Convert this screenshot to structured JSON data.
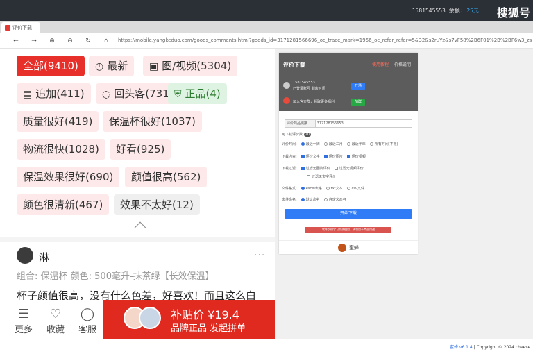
{
  "topbar": {
    "account": "1581545553",
    "balance_label": "余额:",
    "balance": "25元",
    "watermark": "搜狐号"
  },
  "tab": {
    "title": "评价下载"
  },
  "nav": {
    "icons": [
      "back-icon",
      "forward-icon",
      "zoom-in-icon",
      "zoom-out-icon",
      "reload-icon",
      "home-icon"
    ],
    "url": "https://mobile.yangkeduo.com/goods_comments.html?goods_id=3171281566696_oc_trace_mark=1956_oc_refer_refer=5&32&s2ruYz&s7vF58%2B6F01%2B%2BF6w3_zsH_gallery=https%3A%2F%2Fimg.pddpic"
  },
  "tags": [
    {
      "label": "全部(9410)",
      "icon": "",
      "style": "active"
    },
    {
      "label": "最新",
      "icon": "clock-icon",
      "style": "normal"
    },
    {
      "label": "图/视频(5304)",
      "icon": "image-icon",
      "style": "normal"
    },
    {
      "label": "追加(411)",
      "icon": "note-icon",
      "style": "normal"
    },
    {
      "label": "回头客(731)",
      "icon": "chat-icon",
      "style": "normal"
    },
    {
      "label": "正品(4)",
      "icon": "shield-check-icon",
      "style": "green"
    },
    {
      "label": "质量很好(419)",
      "icon": "",
      "style": "normal"
    },
    {
      "label": "保温杯很好(1037)",
      "icon": "",
      "style": "normal"
    },
    {
      "label": "物流很快(1028)",
      "icon": "",
      "style": "normal"
    },
    {
      "label": "好看(925)",
      "icon": "",
      "style": "normal"
    },
    {
      "label": "保温效果很好(690)",
      "icon": "",
      "style": "normal"
    },
    {
      "label": "颜值很高(562)",
      "icon": "",
      "style": "normal"
    },
    {
      "label": "颜色很清新(467)",
      "icon": "",
      "style": "normal"
    },
    {
      "label": "效果不太好(12)",
      "icon": "",
      "style": "grey"
    }
  ],
  "review": {
    "user": "淋",
    "combo": "组合: 保温杯 颜色: 500毫升-抹茶绿【长效保温】",
    "text": "杯子颜值很高，没有什么色差，好喜欢！而且这么白"
  },
  "bottom": {
    "more": "更多",
    "fav": "收藏",
    "service": "客服",
    "price_line": "补贴价 ¥19.4",
    "promo_line": "品牌正品 发起拼单"
  },
  "panel": {
    "title": "评价下载",
    "link1": "使用教程",
    "link2": "价格说明",
    "acc_id": "1581545553",
    "acc_l2": "已登录账号  剩余时间",
    "btn_blue": "开通",
    "invite": "加入官方群，领取更多福利",
    "btn_green": "加群",
    "input_label": "评价商品链接",
    "input_value": "317128156653",
    "count_label": "可下载评价数",
    "count_value": "20",
    "r1_label": "评价时间:",
    "r1": [
      "最近一周",
      "最近三月",
      "最近半年",
      "所有时间(不限)"
    ],
    "r2_label": "下载内容:",
    "r2": [
      "评价文字",
      "评价图片",
      "评价视频"
    ],
    "r3_label": "下载过滤:",
    "r3": [
      "过滤无图片评价",
      "过滤无视频评价"
    ],
    "r3b": "过滤无文字评价",
    "r4_label": "文件格式:",
    "r4": [
      "excel表格",
      "txt文本",
      "csv文件"
    ],
    "r5_label": "文件命名:",
    "r5": [
      "默认命名",
      "自定义命名"
    ],
    "start": "开始下载",
    "warn": "软件仅供学习交流使用，请勿用于商业用途",
    "brand": "蜜蜂"
  },
  "footer": {
    "version": "蜜蜂 v6.1.4",
    "copy": " | Copyright © 2024 cheese"
  }
}
